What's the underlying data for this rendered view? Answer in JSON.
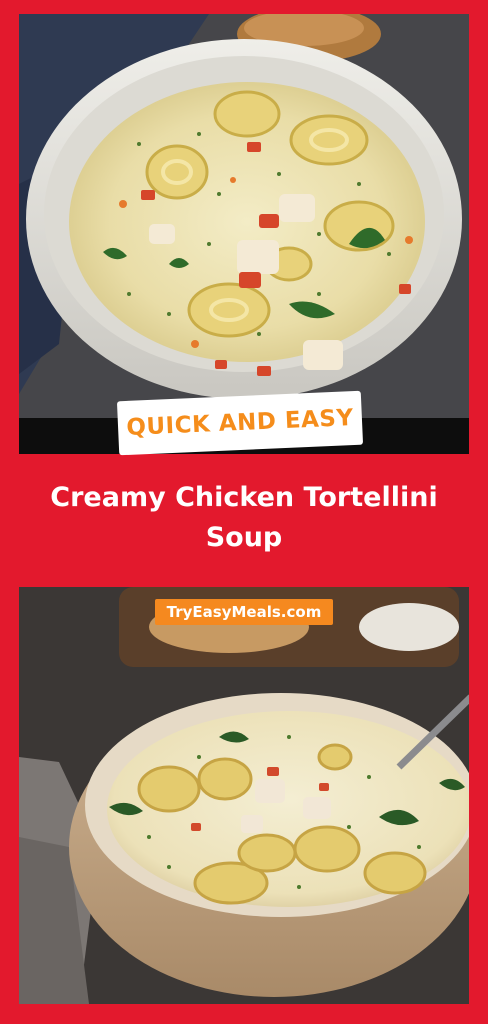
{
  "badge": {
    "text": "QUICK AND EASY"
  },
  "title": {
    "line1": "Creamy Chicken Tortellini",
    "line2": "Soup"
  },
  "watermark": {
    "text": "TryEasyMeals.com"
  },
  "colors": {
    "background": "#e3192d",
    "badge_text": "#f58d1b",
    "badge_bg": "#ffffff",
    "watermark_bg": "#f5891f",
    "title_text": "#ffffff"
  }
}
